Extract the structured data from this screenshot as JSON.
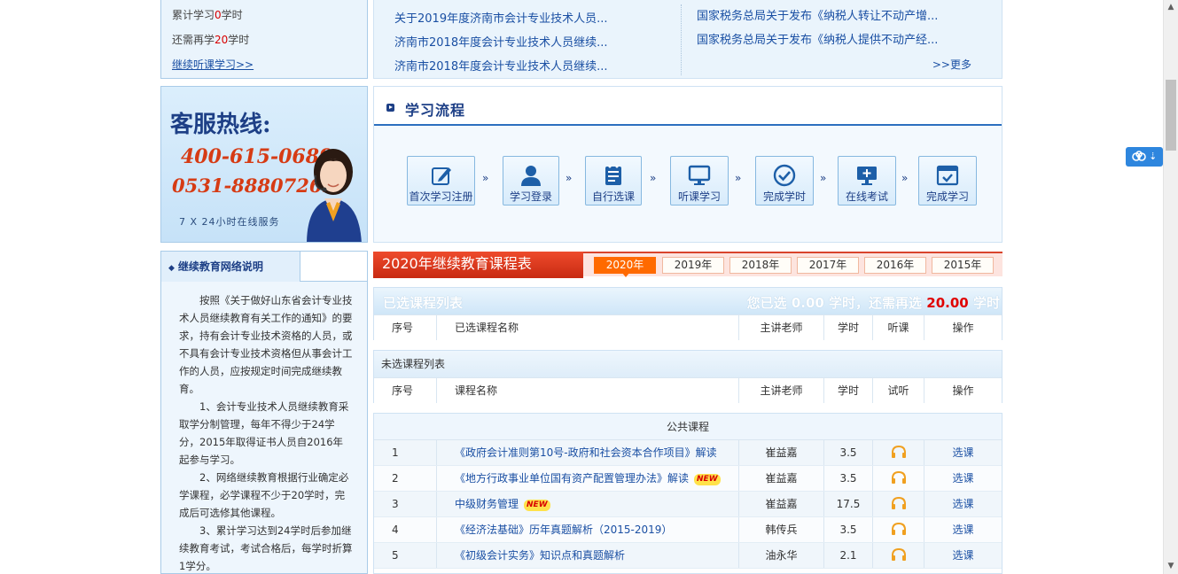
{
  "study_box": {
    "accumulated_prefix": "累计学习",
    "accumulated_value": "0",
    "accumulated_suffix": "学时",
    "remaining_prefix": "还需再学",
    "remaining_value": "20",
    "remaining_suffix": "学时",
    "continue_link": "继续听课学习>>"
  },
  "hotline": {
    "title": "客服热线:",
    "phone1": "400-615-0689",
    "phone2": "0531-88807265",
    "service": "7 X 24小时在线服务"
  },
  "net_desc": {
    "title": "继续教育网络说明",
    "paragraphs": [
      "按照《关于做好山东省会计专业技术人员继续教育有关工作的通知》的要求，持有会计专业技术资格的人员，或不具有会计专业技术资格但从事会计工作的人员，应按规定时间完成继续教育。",
      "1、会计专业技术人员继续教育采取学分制管理，每年不得少于24学分，2015年取得证书人员自2016年起参与学习。",
      "2、网络继续教育根据行业确定必学课程，必学课程不少于20学时，完成后可选修其他课程。",
      "3、累计学习达到24学时后参加继续教育考试，考试合格后，每学时折算1学分。"
    ]
  },
  "news": {
    "left": [
      "关于2019年度济南市会计专业技术人员...",
      "济南市2018年度会计专业技术人员继续...",
      "济南市2018年度会计专业技术人员继续..."
    ],
    "right": [
      "国家税务总局关于发布《纳税人转让不动产增...",
      "国家税务总局关于发布《纳税人提供不动产经..."
    ],
    "more": ">>更多"
  },
  "flow": {
    "title": "学习流程",
    "steps": [
      "首次学习注册",
      "学习登录",
      "自行选课",
      "听课学习",
      "完成学时",
      "在线考试",
      "完成学习"
    ],
    "arrow": "»"
  },
  "schedule": {
    "title": "2020年继续教育课程表",
    "years": [
      "2020年",
      "2019年",
      "2018年",
      "2017年",
      "2016年",
      "2015年"
    ],
    "active_year": "2020年"
  },
  "selected": {
    "title": "已选课程列表",
    "summary_prefix": "您已选 0.00 学时，还需再选",
    "summary_required": "20.00",
    "summary_suffix": "学时",
    "columns": [
      "序号",
      "已选课程名称",
      "主讲老师",
      "学时",
      "听课",
      "操作"
    ]
  },
  "unselected": {
    "title": "未选课程列表",
    "columns": [
      "序号",
      "课程名称",
      "主讲老师",
      "学时",
      "试听",
      "操作"
    ]
  },
  "public_courses": {
    "category": "公共课程",
    "action_label": "选课",
    "rows": [
      {
        "no": "1",
        "name": "《政府会计准则第10号-政府和社会资本合作项目》解读",
        "teacher": "崔益嘉",
        "hours": "3.5",
        "is_new": false
      },
      {
        "no": "2",
        "name": "《地方行政事业单位国有资产配置管理办法》解读",
        "teacher": "崔益嘉",
        "hours": "3.5",
        "is_new": true
      },
      {
        "no": "3",
        "name": "中级财务管理",
        "teacher": "崔益嘉",
        "hours": "17.5",
        "is_new": true
      },
      {
        "no": "4",
        "name": "《经济法基础》历年真题解析（2015-2019）",
        "teacher": "韩传兵",
        "hours": "3.5",
        "is_new": false
      },
      {
        "no": "5",
        "name": "《初级会计实务》知识点和真题解析",
        "teacher": "油永华",
        "hours": "2.1",
        "is_new": false
      }
    ],
    "new_badge": "NEW"
  },
  "colors": {
    "accent_blue": "#1d3f86",
    "link_blue": "#1a4fa3",
    "red": "#d63b14",
    "orange": "#ff6a00"
  }
}
